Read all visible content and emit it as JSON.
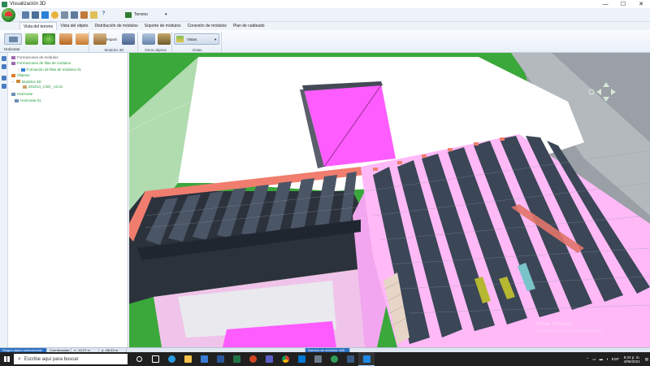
{
  "window": {
    "title": "Visualización 3D",
    "controls": [
      "—",
      "☐",
      "✕"
    ]
  },
  "quick_access": {
    "dropdown_label": "Terreno"
  },
  "tabs": [
    "Vista del terreno",
    "Vista del objeto",
    "Distribución de módulos",
    "Soporte de módulos",
    "Conexión de módulos",
    "Plan de cableado"
  ],
  "ribbon": {
    "groups": [
      {
        "label": ""
      },
      {
        "label": "Modelos 3D"
      },
      {
        "label": "Otros objetos"
      },
      {
        "label": "Vistas"
      }
    ],
    "horizonte_label": "Horizonte",
    "import_label": "Import",
    "vistas_label": "Vistas"
  },
  "tree": [
    {
      "label": "Formaciones de módulos",
      "color": "#555555"
    },
    {
      "label": "Formaciones de filas de módulos",
      "color": "#1f9a3a"
    },
    {
      "label": "Formación de filas de módulos 01",
      "color": "#1f9a3a"
    },
    {
      "label": "Objetos",
      "color": "#1f9a3a"
    },
    {
      "label": "Modelos 3D",
      "color": "#1f9a3a"
    },
    {
      "label": "201014_COD_ v2.01",
      "color": "#1f9a3a"
    },
    {
      "label": "Horizonte",
      "color": "#1f9a3a"
    },
    {
      "label": "Horizonte 01",
      "color": "#1f9a3a"
    }
  ],
  "statusbar": {
    "selection": "Ningún objeto seleccionado",
    "coords_label": "Coordenadas:",
    "x": "x: -10,97 m",
    "y": "y: -68,93 m",
    "modules": "Número de módulos: 465"
  },
  "taskbar": {
    "search_placeholder": "Escribe aquí para buscar",
    "lang": "ESP",
    "time": "8:22 p. m.",
    "date": "4/05/2021"
  },
  "watermark": [
    "Activar Windows",
    "Ve a Configuración para activar Windows."
  ],
  "colors": {
    "grass": "#3aa83a",
    "roof_pink": "#ff5cff",
    "panel": "#3b4656",
    "parapet": "#f07d6e",
    "white_roof": "#ffffff",
    "accent": "#2c6fbf"
  }
}
